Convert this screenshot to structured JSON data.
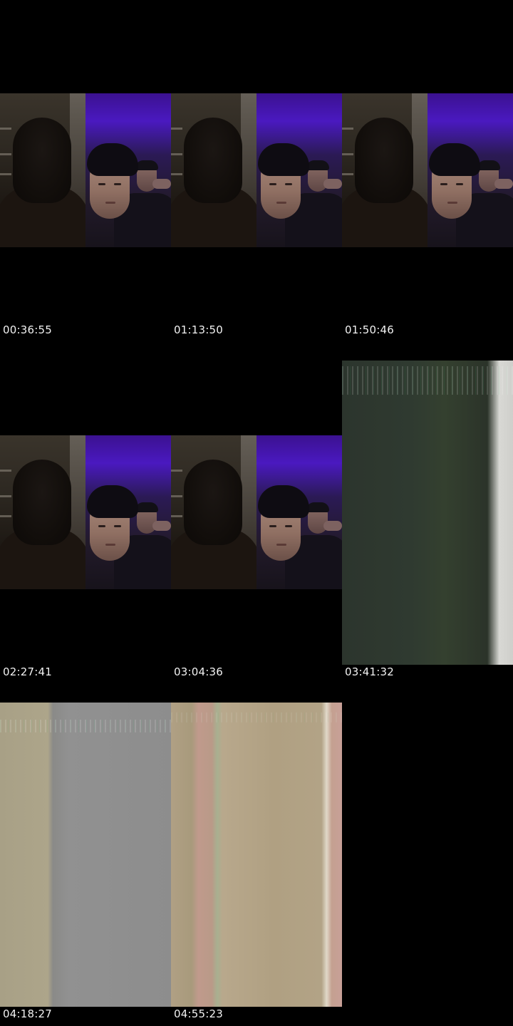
{
  "contact_sheet": {
    "frames": [
      {
        "timestamp": "00:36:55",
        "kind": "video-call"
      },
      {
        "timestamp": "01:13:50",
        "kind": "video-call"
      },
      {
        "timestamp": "01:50:46",
        "kind": "video-call"
      },
      {
        "timestamp": "02:27:41",
        "kind": "video-call"
      },
      {
        "timestamp": "03:04:36",
        "kind": "video-call"
      },
      {
        "timestamp": "03:41:32",
        "kind": "glitch-green"
      },
      {
        "timestamp": "04:18:27",
        "kind": "glitch-beige"
      },
      {
        "timestamp": "04:55:23",
        "kind": "glitch-rose"
      }
    ]
  },
  "colors": {
    "background": "#000000",
    "timestamp_text": "#f2f2f2",
    "call_right_backdrop": "#4a19c0"
  }
}
